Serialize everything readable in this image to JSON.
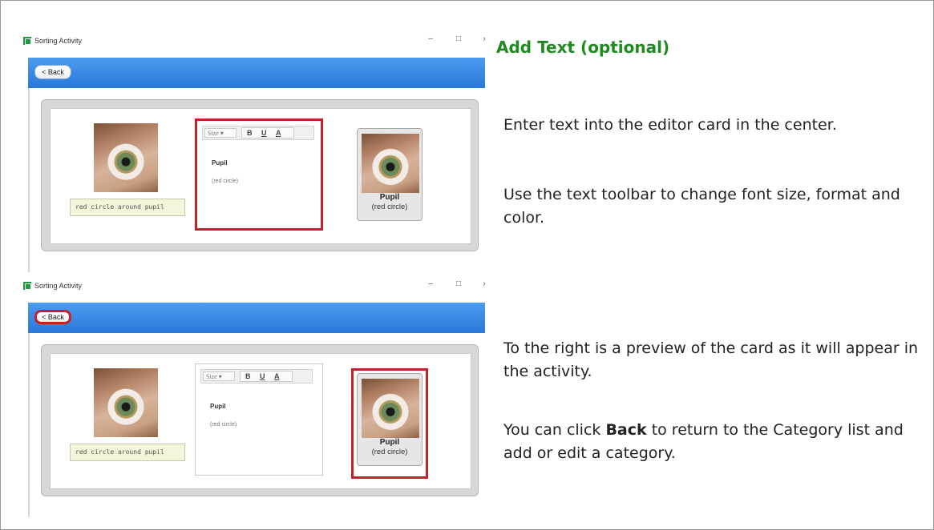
{
  "heading": "Add Text (optional)",
  "paragraphs": {
    "p1": "Enter text into the editor card in the center.",
    "p2": "Use the text toolbar to change font size, format and color.",
    "p3": "To the right is a preview of the card as it will appear in the activity.",
    "p4_before": "You can click ",
    "p4_bold": "Back",
    "p4_after": " to return to the Category list and add or edit a category."
  },
  "screenshots": [
    {
      "window_title": "Sorting Activity",
      "back_label": "Back",
      "back_chevron": "<",
      "caption_text": "red circle around pupil",
      "toolbar": {
        "size_label": "Size",
        "bold": "B",
        "underline": "U",
        "color": "A"
      },
      "editor_title": "Pupil",
      "editor_subtitle": "(red circle)",
      "preview_title": "Pupil",
      "preview_subtitle": "(red circle)",
      "highlight": "editor"
    },
    {
      "window_title": "Sorting Activity",
      "back_label": "Back",
      "back_chevron": "<",
      "caption_text": "red circle around pupil",
      "toolbar": {
        "size_label": "Size",
        "bold": "B",
        "underline": "U",
        "color": "A"
      },
      "editor_title": "Pupil",
      "editor_subtitle": "(red circle)",
      "preview_title": "Pupil",
      "preview_subtitle": "(red circle)",
      "highlight": "back-and-preview"
    }
  ],
  "colors": {
    "heading": "#1e8b1e",
    "highlight": "#c4202c",
    "bluebar": "#2a78d8"
  }
}
